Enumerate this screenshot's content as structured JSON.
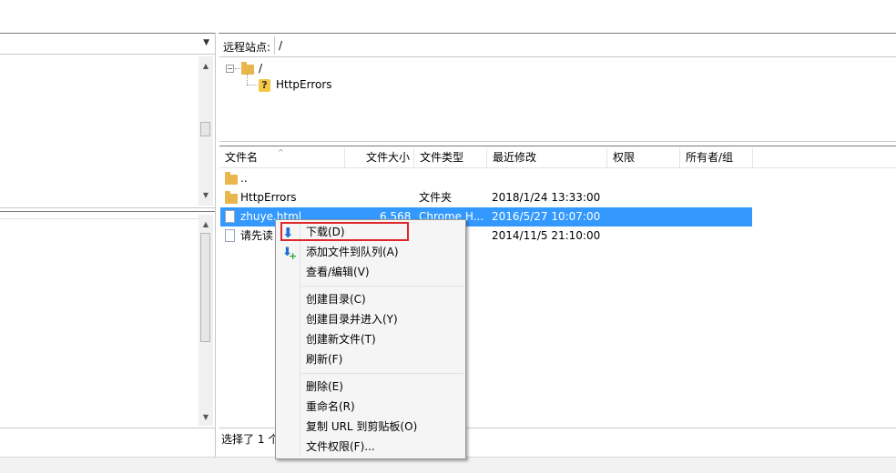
{
  "local_panel": {
    "path_dropdown_value": ""
  },
  "remote": {
    "site_label": "远程站点:",
    "site_path": "/",
    "tree": {
      "root_label": "/",
      "child_label": "HttpErrors"
    }
  },
  "file_list": {
    "columns": [
      "文件名",
      "文件大小",
      "文件类型",
      "最近修改",
      "权限",
      "所有者/组"
    ],
    "rows": [
      {
        "name": "..",
        "size": "",
        "type": "",
        "modified": "",
        "icon": "folder-up-icon"
      },
      {
        "name": "HttpErrors",
        "size": "",
        "type": "文件夹",
        "modified": "2018/1/24 13:33:00",
        "icon": "folder-icon"
      },
      {
        "name": "zhuye.html",
        "size": "6,568",
        "type": "Chrome H...",
        "modified": "2016/5/27 10:07:00",
        "icon": "html-file-icon"
      },
      {
        "name": "请先读",
        "size": "",
        "type": "",
        "modified": "2014/11/5 21:10:00",
        "icon": "text-file-icon"
      }
    ],
    "status_text": "选择了 1 个"
  },
  "context_menu": {
    "items": [
      {
        "label": "下载(D)",
        "icon": "download-arrow-icon"
      },
      {
        "label": "添加文件到队列(A)",
        "icon": "add-to-queue-icon"
      },
      {
        "label": "查看/编辑(V)"
      },
      {
        "label": "创建目录(C)"
      },
      {
        "label": "创建目录并进入(Y)"
      },
      {
        "label": "创建新文件(T)"
      },
      {
        "label": "刷新(F)"
      },
      {
        "label": "删除(E)"
      },
      {
        "label": "重命名(R)"
      },
      {
        "label": "复制 URL 到剪贴板(O)"
      },
      {
        "label": "文件权限(F)..."
      }
    ]
  },
  "colors": {
    "selection": "#3399ff",
    "highlight_border": "#e0262b",
    "menu_bg": "#f5f5f5"
  }
}
